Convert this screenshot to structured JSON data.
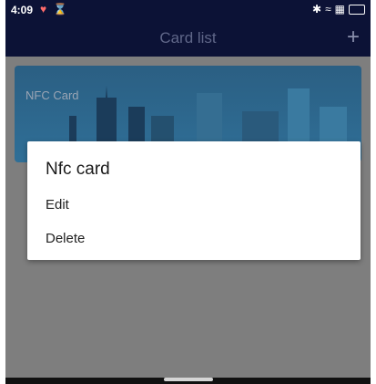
{
  "status_bar": {
    "time": "4:09",
    "left_icons": [
      "heart-icon",
      "hourglass-icon"
    ],
    "right_icons": [
      "bluetooth-icon",
      "wifi-icon",
      "signal-icon",
      "battery-icon"
    ]
  },
  "app_bar": {
    "title": "Card list",
    "add_icon": "plus-icon"
  },
  "card": {
    "label": "NFC Card"
  },
  "dialog": {
    "title": "Nfc card",
    "options": [
      "Edit",
      "Delete"
    ]
  },
  "colors": {
    "header": "#0c1236",
    "overlay": "#7e7e7e",
    "card": "#2f6f97",
    "dialog": "#ffffff"
  }
}
